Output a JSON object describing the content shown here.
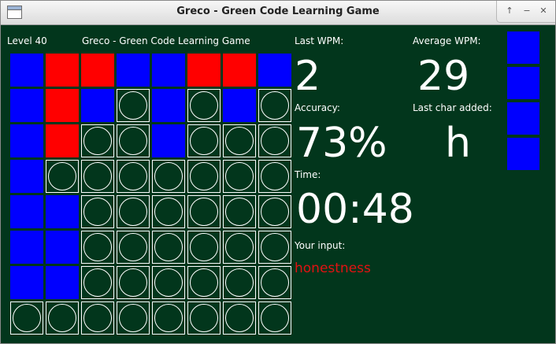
{
  "window": {
    "title": "Greco - Green Code Learning Game",
    "controls": [
      "↑",
      "−",
      "✕"
    ]
  },
  "header": {
    "level": "Level 40",
    "game_title": "Greco - Green Code Learning Game"
  },
  "stats": {
    "last_wpm_label": "Last WPM:",
    "last_wpm": "2",
    "avg_wpm_label": "Average WPM:",
    "avg_wpm": "29",
    "accuracy_label": "Accuracy:",
    "accuracy": "73%",
    "last_char_label": "Last char added:",
    "last_char": "h",
    "time_label": "Time:",
    "time": "00:48",
    "input_label": "Your input:",
    "input_value": "honestness"
  },
  "colors": {
    "background": "#02361c",
    "blue": "#0000ff",
    "red": "#ff0000",
    "input_text": "#e31212"
  },
  "board": [
    [
      "B",
      "R",
      "R",
      "B",
      "B",
      "R",
      "R",
      "B"
    ],
    [
      "B",
      "R",
      "B",
      "E",
      "B",
      "E",
      "B",
      "E"
    ],
    [
      "B",
      "R",
      "E",
      "E",
      "B",
      "E",
      "E",
      "E"
    ],
    [
      "B",
      "E",
      "E",
      "E",
      "E",
      "E",
      "E",
      "E"
    ],
    [
      "B",
      "B",
      "E",
      "E",
      "E",
      "E",
      "E",
      "E"
    ],
    [
      "B",
      "B",
      "E",
      "E",
      "E",
      "E",
      "E",
      "E"
    ],
    [
      "B",
      "B",
      "E",
      "E",
      "E",
      "E",
      "E",
      "E"
    ],
    [
      "E",
      "E",
      "E",
      "E",
      "E",
      "E",
      "E",
      "E"
    ]
  ],
  "queue": [
    "B",
    "B",
    "B",
    "B"
  ]
}
